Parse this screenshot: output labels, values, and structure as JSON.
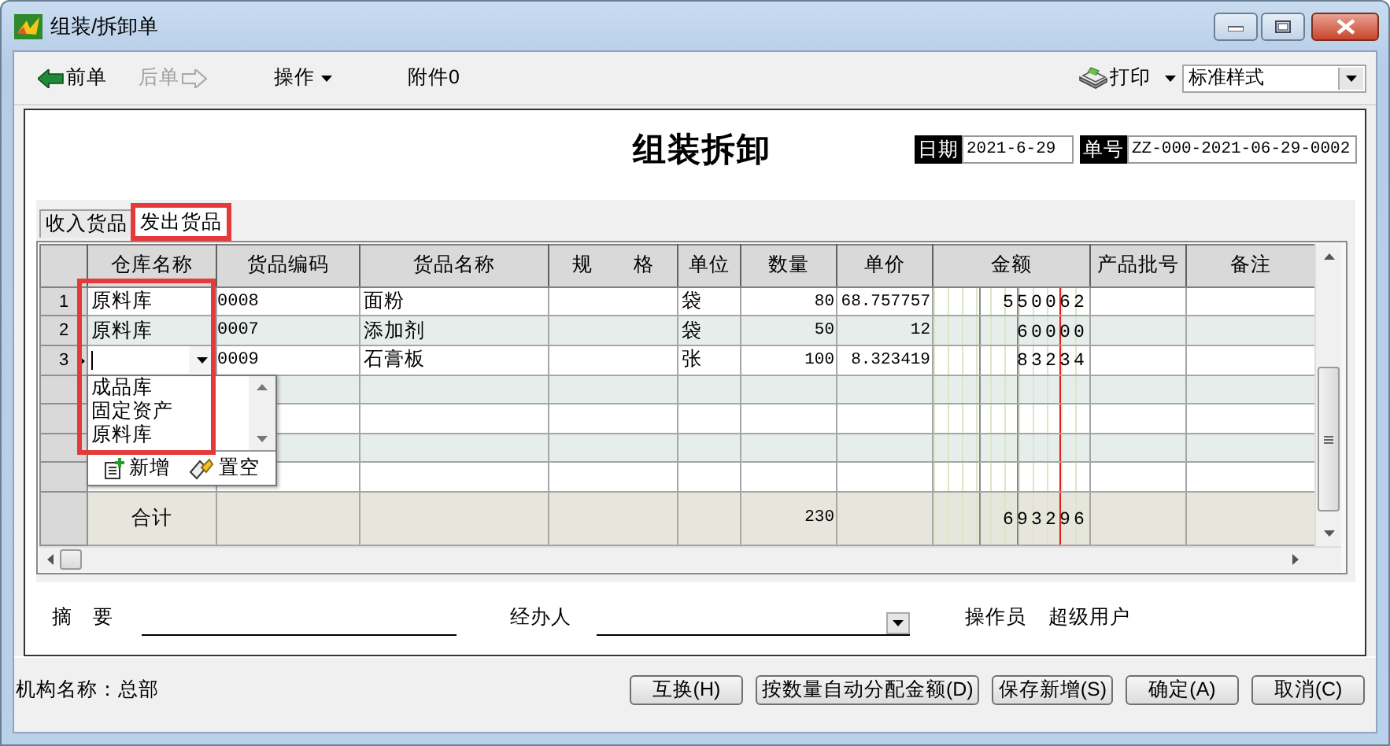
{
  "window": {
    "title": "组装/拆卸单"
  },
  "toolbar": {
    "items": [
      {
        "label": "前单",
        "kind": "back",
        "disabled": false
      },
      {
        "label": "后单",
        "kind": "forward",
        "disabled": true
      },
      {
        "label": "操作",
        "kind": "menu",
        "disabled": false
      },
      {
        "label": "附件0",
        "kind": "plain",
        "disabled": false
      }
    ],
    "print": {
      "label": "打印"
    },
    "style_select": {
      "value": "标准样式"
    }
  },
  "bill": {
    "title": "组装拆卸",
    "date_label": "日期",
    "date": "2021-6-29",
    "number_label": "单号",
    "number": "ZZ-000-2021-06-29-0002"
  },
  "tabs": [
    {
      "label": "收入货品",
      "selected": false,
      "highlighted": false
    },
    {
      "label": "发出货品",
      "selected": true,
      "highlighted": true
    }
  ],
  "table": {
    "columns": [
      "仓库名称",
      "货品编码",
      "货品名称",
      "规　　格",
      "单位",
      "数量",
      "单价",
      "金额",
      "产品批号",
      "备注"
    ],
    "rows": [
      {
        "number": "1",
        "warehouse": "原料库",
        "code": "0008",
        "name": "面粉",
        "unit": "袋",
        "quantity": "80",
        "price": "68.757757",
        "amount": "550062",
        "current": false,
        "editing": false
      },
      {
        "number": "2",
        "warehouse": "原料库",
        "code": "0007",
        "name": "添加剂",
        "unit": "袋",
        "quantity": "50",
        "price": "12",
        "amount": "60000",
        "current": false,
        "editing": false
      },
      {
        "number": "3",
        "code": "0009",
        "name": "石膏板",
        "unit": "张",
        "quantity": "100",
        "price": "8.323419",
        "amount": "83234",
        "current": true,
        "editing": true
      }
    ],
    "total": {
      "label": "合计",
      "quantity": "230",
      "amount": "693296"
    }
  },
  "warehouse_dropdown": {
    "options": [
      "成品库",
      "固定资产",
      "原料库"
    ],
    "actions": [
      {
        "label": "新增",
        "kind": "add"
      },
      {
        "label": "置空",
        "kind": "clear"
      }
    ],
    "highlighted": true
  },
  "footer": {
    "summary_label": "摘　要",
    "handler_label": "经办人",
    "operator_label": "操作员",
    "operator": "超级用户"
  },
  "status_bar": {
    "organization": "机构名称：总部",
    "buttons": [
      "互换(H)",
      "按数量自动分配金额(D)",
      "保存新增(S)",
      "确定(A)",
      "取消(C)"
    ]
  }
}
